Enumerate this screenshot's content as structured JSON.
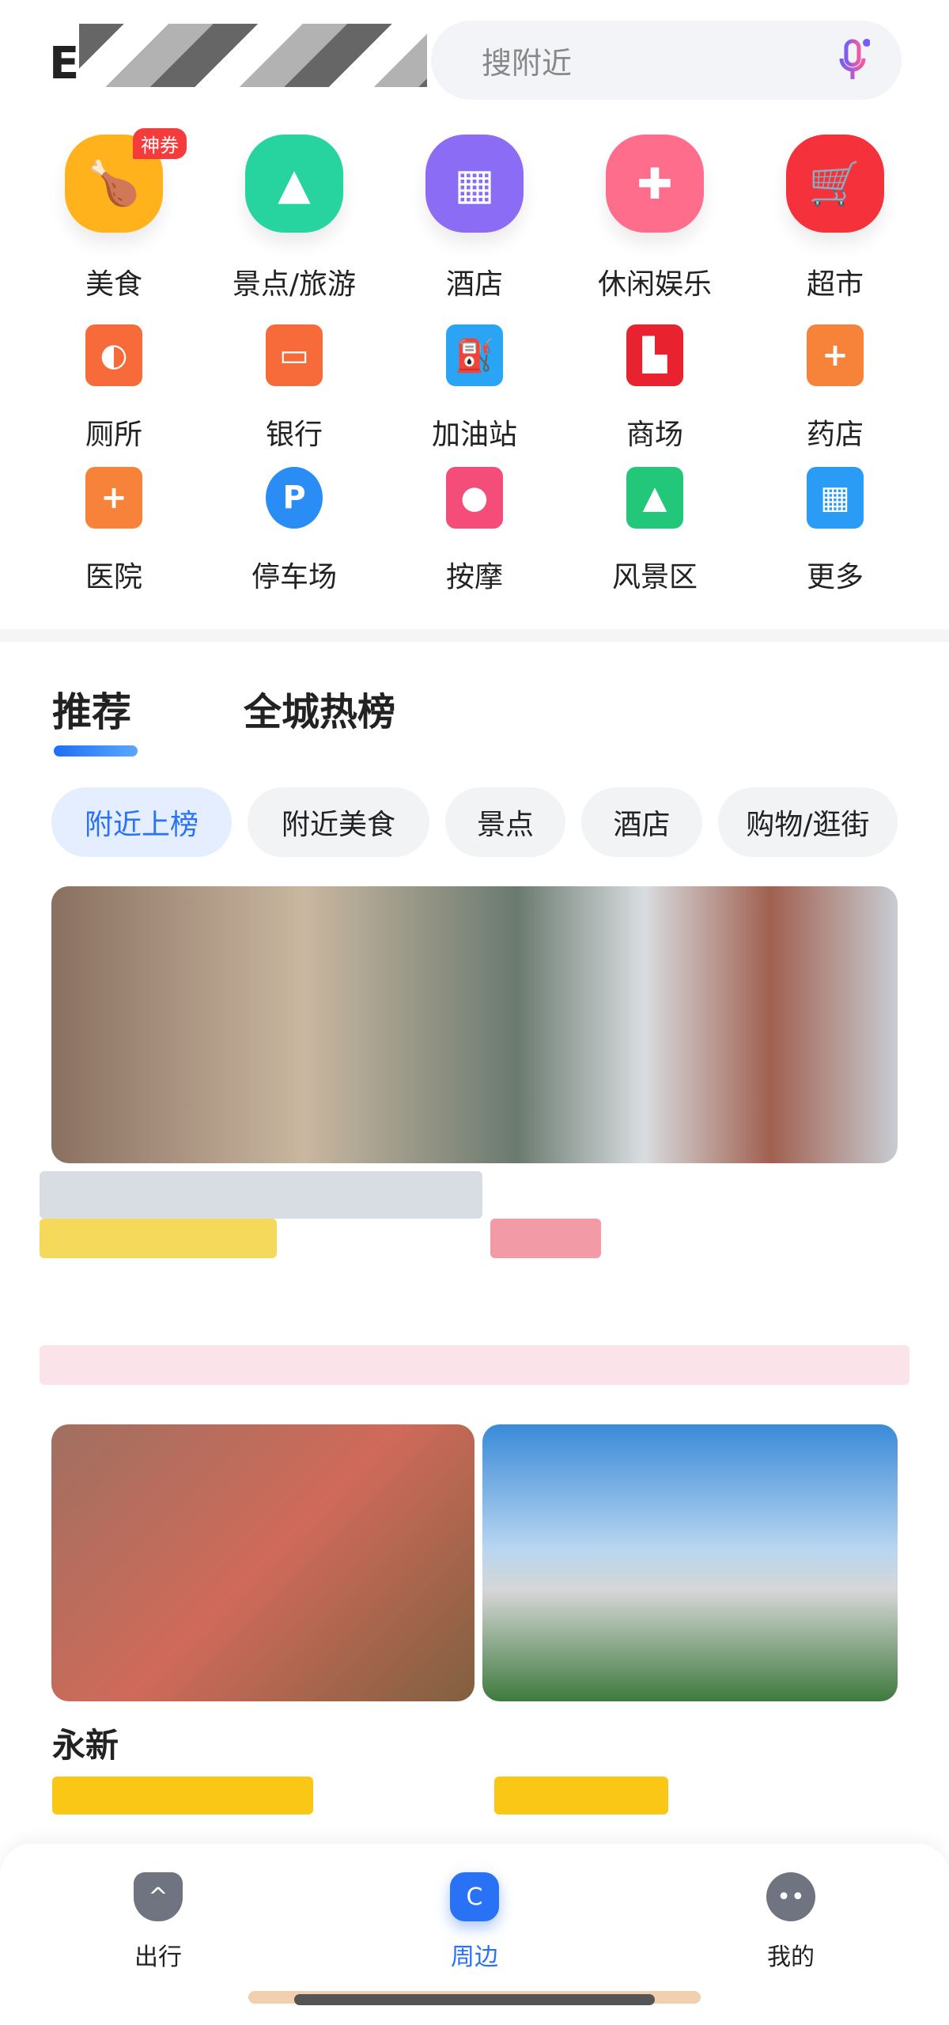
{
  "header": {
    "title_partial": "E",
    "search_placeholder": "搜附近"
  },
  "categories": [
    {
      "label": "美食",
      "icon": "food-icon",
      "color": "#ffb21c",
      "badge": "神券"
    },
    {
      "label": "景点/旅游",
      "icon": "mountain-icon",
      "color": "#27d49f"
    },
    {
      "label": "酒店",
      "icon": "hotel-icon",
      "color": "#8b6cf5"
    },
    {
      "label": "休闲娱乐",
      "icon": "gamepad-icon",
      "color": "#ff6d8c"
    },
    {
      "label": "超市",
      "icon": "cart-icon",
      "color": "#f5323c"
    },
    {
      "label": "厕所",
      "icon": "toilet-icon",
      "color": "#f76a3a"
    },
    {
      "label": "银行",
      "icon": "bank-card-icon",
      "color": "#f76a3a"
    },
    {
      "label": "加油站",
      "icon": "gas-station-icon",
      "color": "#2aa4f5"
    },
    {
      "label": "商场",
      "icon": "mall-icon",
      "color": "#e8232f"
    },
    {
      "label": "药店",
      "icon": "pharmacy-icon",
      "color": "#f7823a"
    },
    {
      "label": "医院",
      "icon": "hospital-icon",
      "color": "#f7823a"
    },
    {
      "label": "停车场",
      "icon": "parking-icon",
      "color": "#2a8cf5"
    },
    {
      "label": "按摩",
      "icon": "massage-icon",
      "color": "#f54d7a"
    },
    {
      "label": "风景区",
      "icon": "scenic-icon",
      "color": "#22c77a"
    },
    {
      "label": "更多",
      "icon": "more-grid-icon",
      "color": "#2a9cf5"
    }
  ],
  "tabs": [
    {
      "label": "推荐",
      "active": true
    },
    {
      "label": "全城热榜",
      "active": false
    }
  ],
  "chips": [
    {
      "label": "附近上榜",
      "active": true
    },
    {
      "label": "附近美食"
    },
    {
      "label": "景点"
    },
    {
      "label": "酒店"
    },
    {
      "label": "购物/逛街"
    }
  ],
  "cards": {
    "partial_title": "永新"
  },
  "nav": [
    {
      "label": "出行",
      "icon": "travel-icon"
    },
    {
      "label": "周边",
      "icon": "nearby-icon",
      "active": true
    },
    {
      "label": "我的",
      "icon": "profile-icon"
    }
  ],
  "colors": {
    "accent": "#2a72f5"
  }
}
